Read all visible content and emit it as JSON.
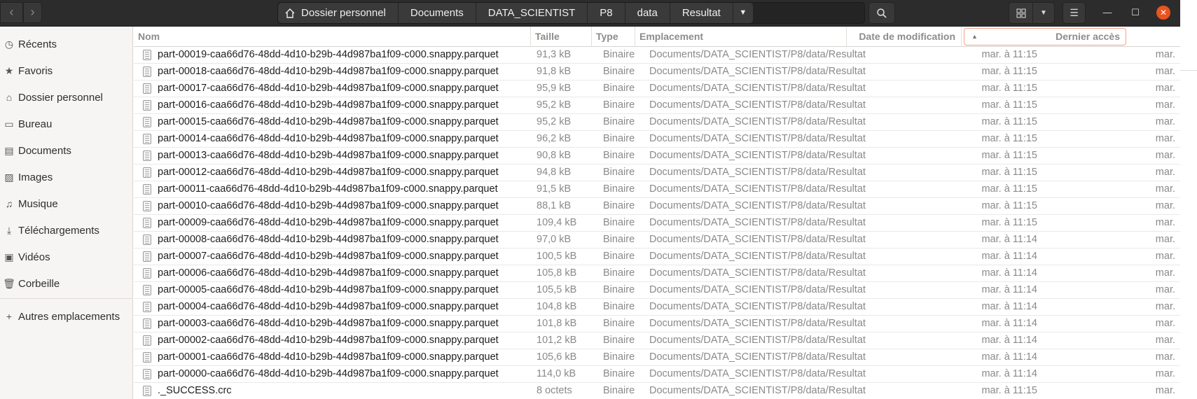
{
  "nav": {
    "back_icon": "‹",
    "forward_icon": "›"
  },
  "breadcrumbs": [
    {
      "label": "Dossier personnel"
    },
    {
      "label": "Documents"
    },
    {
      "label": "DATA_SCIENTIST"
    },
    {
      "label": "P8"
    },
    {
      "label": "data"
    },
    {
      "label": "Resultat"
    }
  ],
  "sidebar": {
    "items": [
      {
        "label": "Récents",
        "icon": "clock-icon"
      },
      {
        "label": "Favoris",
        "icon": "star-icon"
      },
      {
        "label": "Dossier personnel",
        "icon": "home-icon"
      },
      {
        "label": "Bureau",
        "icon": "desktop-icon"
      },
      {
        "label": "Documents",
        "icon": "document-icon"
      },
      {
        "label": "Images",
        "icon": "image-icon"
      },
      {
        "label": "Musique",
        "icon": "music-icon"
      },
      {
        "label": "Téléchargements",
        "icon": "download-icon"
      },
      {
        "label": "Vidéos",
        "icon": "video-icon"
      },
      {
        "label": "Corbeille",
        "icon": "trash-icon"
      },
      {
        "label": "Autres emplacements",
        "icon": "plus-icon"
      }
    ]
  },
  "columns": {
    "name": "Nom",
    "size": "Taille",
    "type": "Type",
    "location": "Emplacement",
    "modified": "Date de modification",
    "accessed": "Dernier accès"
  },
  "files": [
    {
      "name": "part-00019-caa66d76-48dd-4d10-b29b-44d987ba1f09-c000.snappy.parquet",
      "size": "91,3 kB",
      "type": "Binaire",
      "location": "Documents/DATA_SCIENTIST/P8/data/Resultat",
      "modified": "mar. à 11:15",
      "accessed": "mar."
    },
    {
      "name": "part-00018-caa66d76-48dd-4d10-b29b-44d987ba1f09-c000.snappy.parquet",
      "size": "91,8 kB",
      "type": "Binaire",
      "location": "Documents/DATA_SCIENTIST/P8/data/Resultat",
      "modified": "mar. à 11:15",
      "accessed": "mar."
    },
    {
      "name": "part-00017-caa66d76-48dd-4d10-b29b-44d987ba1f09-c000.snappy.parquet",
      "size": "95,9 kB",
      "type": "Binaire",
      "location": "Documents/DATA_SCIENTIST/P8/data/Resultat",
      "modified": "mar. à 11:15",
      "accessed": "mar."
    },
    {
      "name": "part-00016-caa66d76-48dd-4d10-b29b-44d987ba1f09-c000.snappy.parquet",
      "size": "95,2 kB",
      "type": "Binaire",
      "location": "Documents/DATA_SCIENTIST/P8/data/Resultat",
      "modified": "mar. à 11:15",
      "accessed": "mar."
    },
    {
      "name": "part-00015-caa66d76-48dd-4d10-b29b-44d987ba1f09-c000.snappy.parquet",
      "size": "95,2 kB",
      "type": "Binaire",
      "location": "Documents/DATA_SCIENTIST/P8/data/Resultat",
      "modified": "mar. à 11:15",
      "accessed": "mar."
    },
    {
      "name": "part-00014-caa66d76-48dd-4d10-b29b-44d987ba1f09-c000.snappy.parquet",
      "size": "96,2 kB",
      "type": "Binaire",
      "location": "Documents/DATA_SCIENTIST/P8/data/Resultat",
      "modified": "mar. à 11:15",
      "accessed": "mar."
    },
    {
      "name": "part-00013-caa66d76-48dd-4d10-b29b-44d987ba1f09-c000.snappy.parquet",
      "size": "90,8 kB",
      "type": "Binaire",
      "location": "Documents/DATA_SCIENTIST/P8/data/Resultat",
      "modified": "mar. à 11:15",
      "accessed": "mar."
    },
    {
      "name": "part-00012-caa66d76-48dd-4d10-b29b-44d987ba1f09-c000.snappy.parquet",
      "size": "94,8 kB",
      "type": "Binaire",
      "location": "Documents/DATA_SCIENTIST/P8/data/Resultat",
      "modified": "mar. à 11:15",
      "accessed": "mar."
    },
    {
      "name": "part-00011-caa66d76-48dd-4d10-b29b-44d987ba1f09-c000.snappy.parquet",
      "size": "91,5 kB",
      "type": "Binaire",
      "location": "Documents/DATA_SCIENTIST/P8/data/Resultat",
      "modified": "mar. à 11:15",
      "accessed": "mar."
    },
    {
      "name": "part-00010-caa66d76-48dd-4d10-b29b-44d987ba1f09-c000.snappy.parquet",
      "size": "88,1 kB",
      "type": "Binaire",
      "location": "Documents/DATA_SCIENTIST/P8/data/Resultat",
      "modified": "mar. à 11:15",
      "accessed": "mar."
    },
    {
      "name": "part-00009-caa66d76-48dd-4d10-b29b-44d987ba1f09-c000.snappy.parquet",
      "size": "109,4 kB",
      "type": "Binaire",
      "location": "Documents/DATA_SCIENTIST/P8/data/Resultat",
      "modified": "mar. à 11:15",
      "accessed": "mar."
    },
    {
      "name": "part-00008-caa66d76-48dd-4d10-b29b-44d987ba1f09-c000.snappy.parquet",
      "size": "97,0 kB",
      "type": "Binaire",
      "location": "Documents/DATA_SCIENTIST/P8/data/Resultat",
      "modified": "mar. à 11:14",
      "accessed": "mar."
    },
    {
      "name": "part-00007-caa66d76-48dd-4d10-b29b-44d987ba1f09-c000.snappy.parquet",
      "size": "100,5 kB",
      "type": "Binaire",
      "location": "Documents/DATA_SCIENTIST/P8/data/Resultat",
      "modified": "mar. à 11:14",
      "accessed": "mar."
    },
    {
      "name": "part-00006-caa66d76-48dd-4d10-b29b-44d987ba1f09-c000.snappy.parquet",
      "size": "105,8 kB",
      "type": "Binaire",
      "location": "Documents/DATA_SCIENTIST/P8/data/Resultat",
      "modified": "mar. à 11:14",
      "accessed": "mar."
    },
    {
      "name": "part-00005-caa66d76-48dd-4d10-b29b-44d987ba1f09-c000.snappy.parquet",
      "size": "105,5 kB",
      "type": "Binaire",
      "location": "Documents/DATA_SCIENTIST/P8/data/Resultat",
      "modified": "mar. à 11:14",
      "accessed": "mar."
    },
    {
      "name": "part-00004-caa66d76-48dd-4d10-b29b-44d987ba1f09-c000.snappy.parquet",
      "size": "104,8 kB",
      "type": "Binaire",
      "location": "Documents/DATA_SCIENTIST/P8/data/Resultat",
      "modified": "mar. à 11:14",
      "accessed": "mar."
    },
    {
      "name": "part-00003-caa66d76-48dd-4d10-b29b-44d987ba1f09-c000.snappy.parquet",
      "size": "101,8 kB",
      "type": "Binaire",
      "location": "Documents/DATA_SCIENTIST/P8/data/Resultat",
      "modified": "mar. à 11:14",
      "accessed": "mar."
    },
    {
      "name": "part-00002-caa66d76-48dd-4d10-b29b-44d987ba1f09-c000.snappy.parquet",
      "size": "101,2 kB",
      "type": "Binaire",
      "location": "Documents/DATA_SCIENTIST/P8/data/Resultat",
      "modified": "mar. à 11:14",
      "accessed": "mar."
    },
    {
      "name": "part-00001-caa66d76-48dd-4d10-b29b-44d987ba1f09-c000.snappy.parquet",
      "size": "105,6 kB",
      "type": "Binaire",
      "location": "Documents/DATA_SCIENTIST/P8/data/Resultat",
      "modified": "mar. à 11:14",
      "accessed": "mar."
    },
    {
      "name": "part-00000-caa66d76-48dd-4d10-b29b-44d987ba1f09-c000.snappy.parquet",
      "size": "114,0 kB",
      "type": "Binaire",
      "location": "Documents/DATA_SCIENTIST/P8/data/Resultat",
      "modified": "mar. à 11:14",
      "accessed": "mar."
    },
    {
      "name": "._SUCCESS.crc",
      "size": "8 octets",
      "type": "Binaire",
      "location": "Documents/DATA_SCIENTIST/P8/data/Resultat",
      "modified": "mar. à 11:15",
      "accessed": "mar."
    }
  ],
  "colors": {
    "headerbar": "#2c2c2c",
    "accent": "#e95420",
    "sidebar": "#f6f5f4"
  }
}
